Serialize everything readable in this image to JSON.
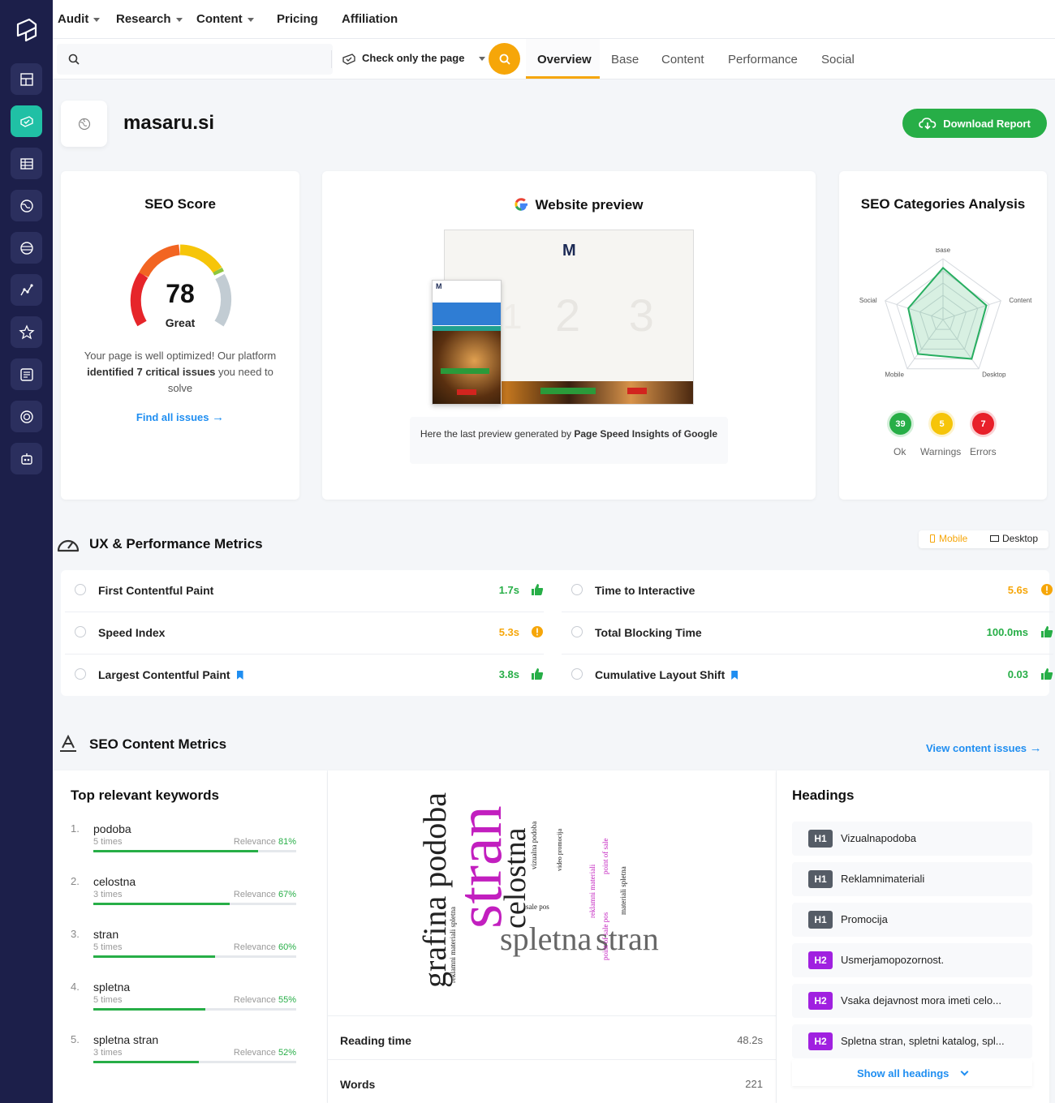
{
  "nav": {
    "items": [
      {
        "label": "Audit",
        "dropdown": true
      },
      {
        "label": "Research",
        "dropdown": true
      },
      {
        "label": "Content",
        "dropdown": true
      },
      {
        "label": "Pricing",
        "dropdown": false
      },
      {
        "label": "Affiliation",
        "dropdown": false
      }
    ]
  },
  "sidebar": {
    "icons": [
      "layout-icon",
      "audit-icon",
      "table-icon",
      "globe-icon",
      "browser-icon",
      "chart-icon",
      "star-icon",
      "report-icon",
      "target-icon",
      "robot-icon"
    ],
    "active_index": 1
  },
  "search": {
    "placeholder": "",
    "mode_label": "Check only the page"
  },
  "tabs": [
    "Overview",
    "Base",
    "Content",
    "Performance",
    "Social"
  ],
  "active_tab": "Overview",
  "domain": "masaru.si",
  "download_label": "Download Report",
  "seo_score": {
    "title": "SEO Score",
    "value": "78",
    "grade": "Great",
    "desc_before": "Your page is well optimized! Our platform ",
    "desc_bold": "identified 7 critical issues",
    "desc_after": " you need to solve",
    "link": "Find all issues"
  },
  "preview": {
    "title": "Website preview",
    "note_before": "Here the last preview generated by ",
    "note_bold": "Page Speed Insights of Google",
    "mock_logo": "M",
    "mock_digits": "2 3",
    "mock_digit_small": "1"
  },
  "categories": {
    "title": "SEO Categories Analysis",
    "axes": [
      "Base",
      "Content",
      "Desktop",
      "Mobile",
      "Social"
    ],
    "values": [
      0.85,
      0.75,
      0.8,
      0.7,
      0.6
    ],
    "counts": [
      {
        "value": "39",
        "label": "Ok",
        "color": "#27ae47"
      },
      {
        "value": "5",
        "label": "Warnings",
        "color": "#f6c509"
      },
      {
        "value": "7",
        "label": "Errors",
        "color": "#e8202a"
      }
    ]
  },
  "ux": {
    "title": "UX & Performance Metrics",
    "toggle_mobile": "Mobile",
    "toggle_desktop": "Desktop",
    "metrics": [
      {
        "name": "First Contentful Paint",
        "value": "1.7s",
        "status": "good",
        "bookmark": false
      },
      {
        "name": "Time to Interactive",
        "value": "5.6s",
        "status": "warn",
        "bookmark": false
      },
      {
        "name": "Speed Index",
        "value": "5.3s",
        "status": "warn",
        "bookmark": false
      },
      {
        "name": "Total Blocking Time",
        "value": "100.0ms",
        "status": "good",
        "bookmark": false
      },
      {
        "name": "Largest Contentful Paint",
        "value": "3.8s",
        "status": "good",
        "bookmark": true
      },
      {
        "name": "Cumulative Layout Shift",
        "value": "0.03",
        "status": "good",
        "bookmark": true
      }
    ]
  },
  "content": {
    "title": "SEO Content Metrics",
    "view_issues": "View content issues",
    "keywords_title": "Top relevant keywords",
    "relevance_label": "Relevance",
    "keywords": [
      {
        "num": "1.",
        "word": "podoba",
        "times": "5 times",
        "relevance": 81
      },
      {
        "num": "2.",
        "word": "celostna",
        "times": "3 times",
        "relevance": 67
      },
      {
        "num": "3.",
        "word": "stran",
        "times": "5 times",
        "relevance": 60
      },
      {
        "num": "4.",
        "word": "spletna",
        "times": "5 times",
        "relevance": 55
      },
      {
        "num": "5.",
        "word": "spletna stran",
        "times": "3 times",
        "relevance": 52
      }
    ],
    "cloud": [
      "grafina podoba",
      "stran",
      "celostna",
      "spletna",
      "stran",
      "reklamni materiali spletna",
      "sale pos",
      "vizualna podoba",
      "video promocija",
      "point of sale",
      "reklamni materiali",
      "point of sale pos",
      "materiali spletna"
    ],
    "stats": [
      {
        "label": "Reading time",
        "value": "48.2s"
      },
      {
        "label": "Words",
        "value": "221"
      }
    ],
    "headings_title": "Headings",
    "headings": [
      {
        "tag": "H1",
        "text": "Vizualnapodoba"
      },
      {
        "tag": "H1",
        "text": "Reklamnimateriali"
      },
      {
        "tag": "H1",
        "text": "Promocija"
      },
      {
        "tag": "H2",
        "text": "Usmerjamopozornost."
      },
      {
        "tag": "H2",
        "text": "Vsaka dejavnost mora imeti celo..."
      },
      {
        "tag": "H2",
        "text": "Spletna stran, spletni katalog, spl..."
      }
    ],
    "show_all": "Show all headings"
  },
  "colors": {
    "sidebar": "#1c1f4a",
    "accent": "#f6a609",
    "green": "#27ae47",
    "teal": "#20c0a5",
    "blue": "#1f8ef1",
    "h1": "#555c66",
    "h2": "#a020e0"
  }
}
